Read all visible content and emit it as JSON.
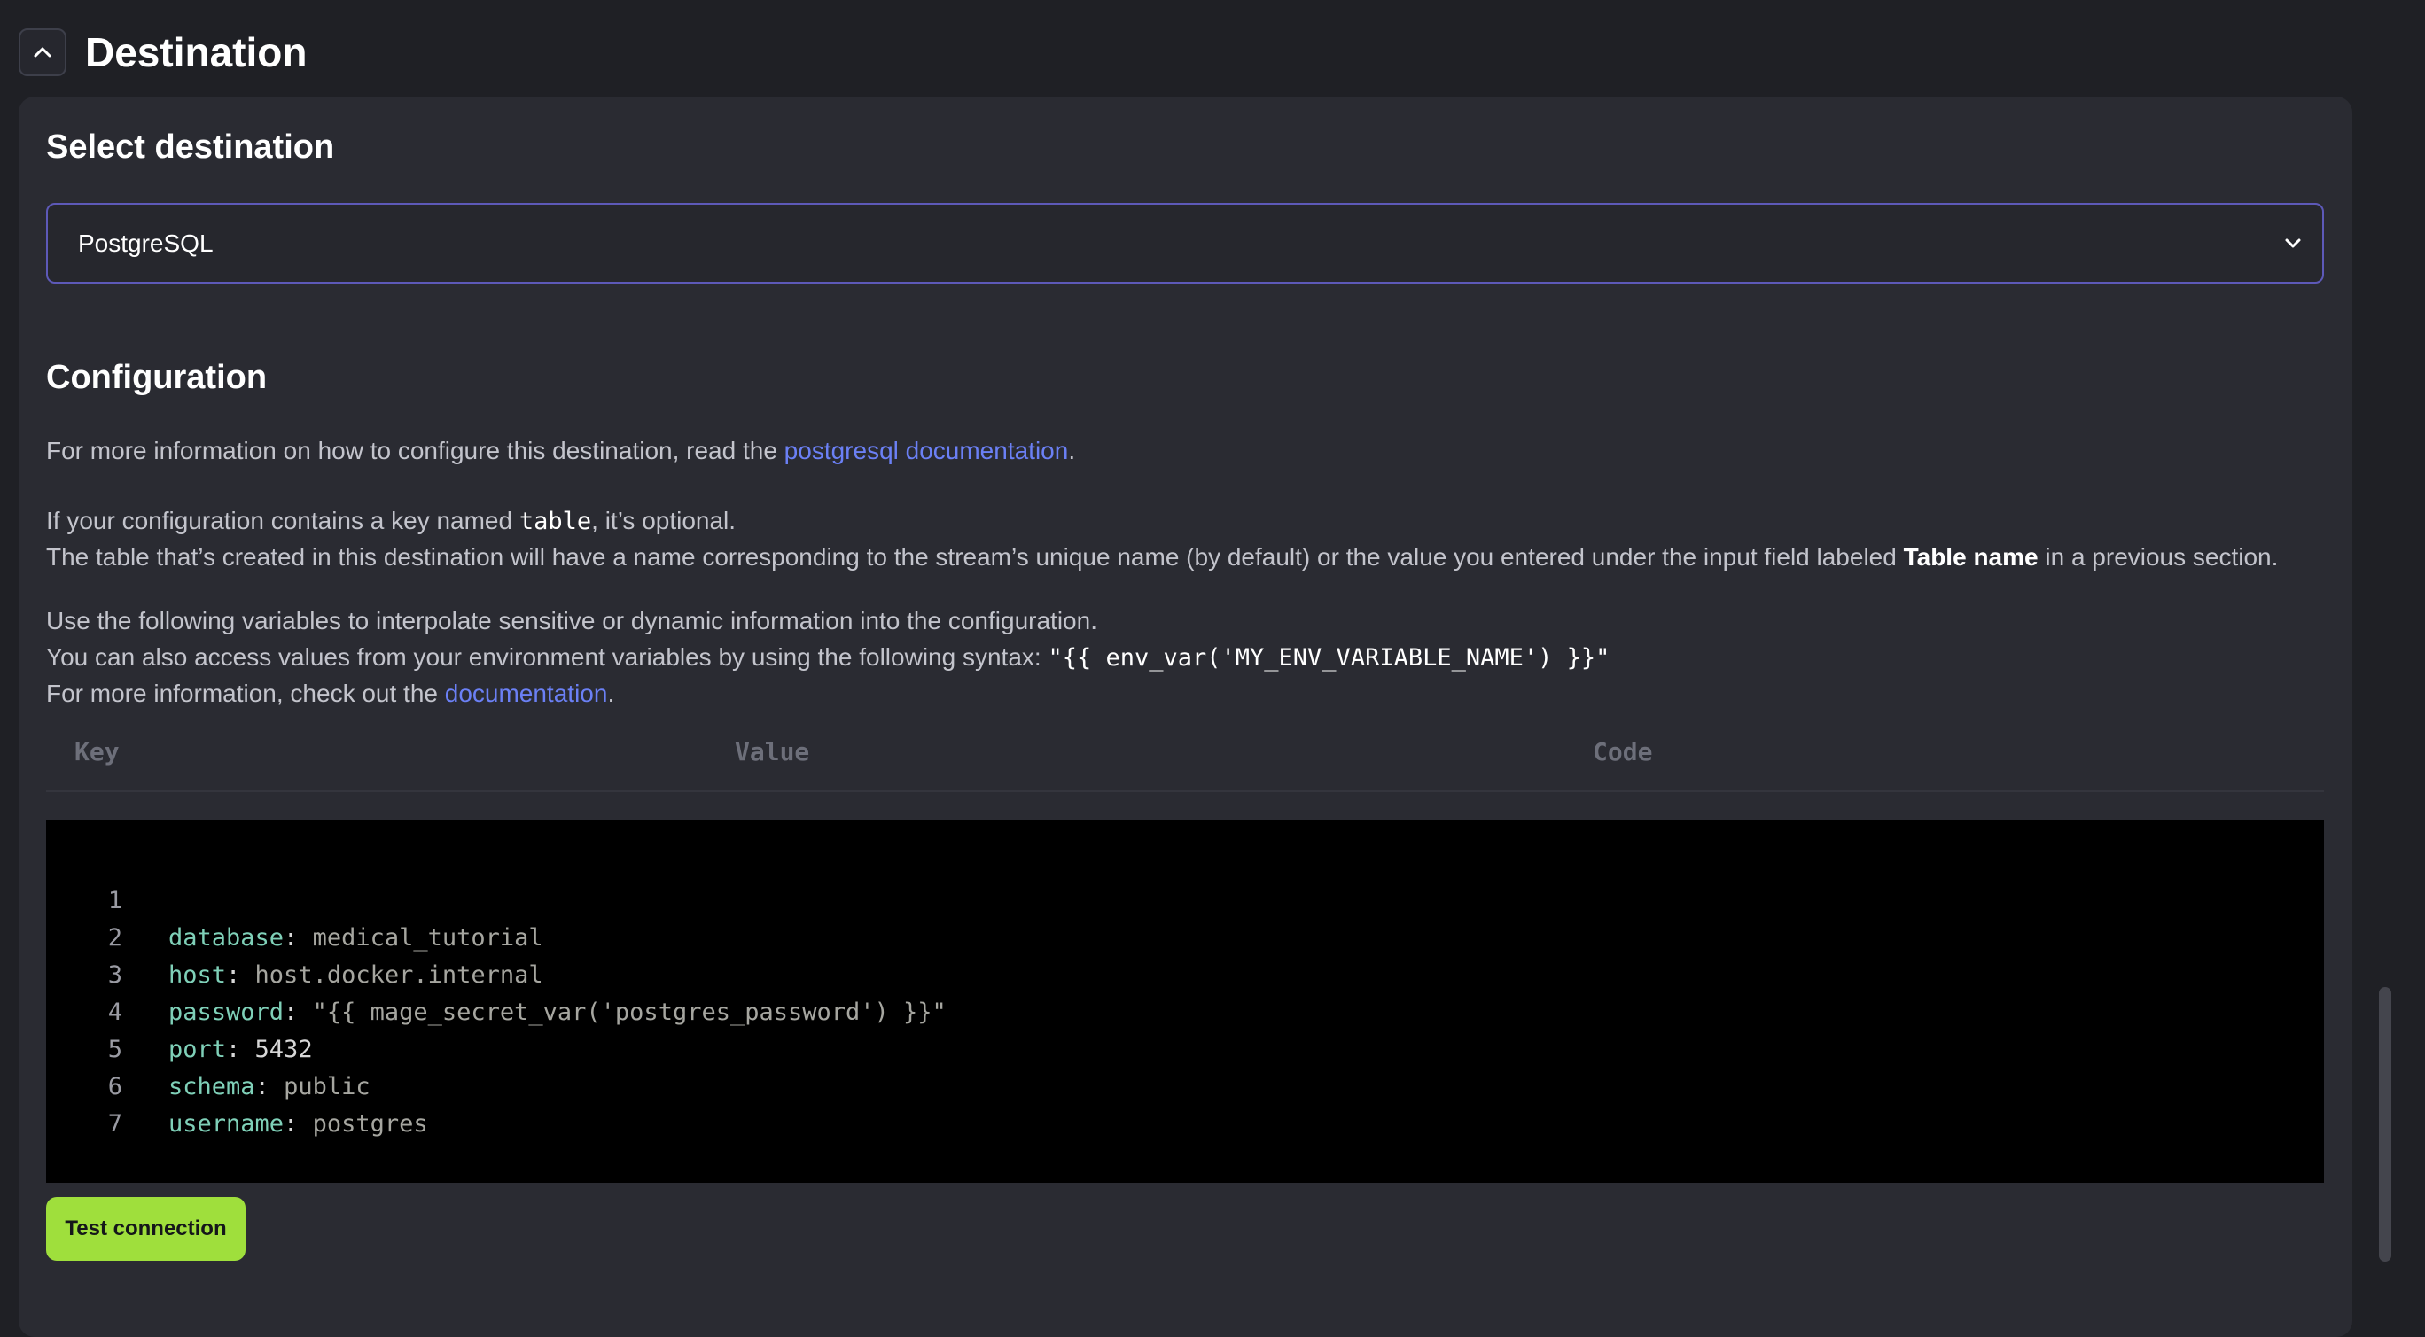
{
  "header": {
    "title": "Destination",
    "collapse_icon": "chevron-up-icon"
  },
  "select_destination": {
    "heading": "Select destination",
    "selected_value": "PostgreSQL",
    "dropdown_icon": "chevron-down-icon"
  },
  "configuration": {
    "heading": "Configuration",
    "info_line1_prefix": "For more information on how to configure this destination, read the ",
    "info_line1_link": "postgresql documentation",
    "info_line1_suffix": ".",
    "table_note_prefix": "If your configuration contains a key named ",
    "table_note_key": "table",
    "table_note_suffix": ", it’s optional.",
    "table_name_prefix": "The table that’s created in this destination will have a name corresponding to the stream’s unique name (by default) or the value you entered under the input field labeled ",
    "table_name_bold": "Table name",
    "table_name_suffix": " in a previous section.",
    "vars_line1": "Use the following variables to interpolate sensitive or dynamic information into the configuration.",
    "vars_line2_prefix": "You can also access values from your environment variables by using the following syntax: ",
    "vars_line2_code": "\"{{ env_var('MY_ENV_VARIABLE_NAME') }}\"",
    "vars_line3_prefix": "For more information, check out the ",
    "vars_line3_link": "documentation",
    "vars_line3_suffix": "."
  },
  "variables_table": {
    "columns": [
      "Key",
      "Value",
      "Code"
    ]
  },
  "editor": {
    "lines": [
      {
        "num": "1",
        "key": "database",
        "value": "medical_tutorial"
      },
      {
        "num": "2",
        "key": "host",
        "value": "host.docker.internal"
      },
      {
        "num": "3",
        "key": "password",
        "value": "\"{{ mage_secret_var('postgres_password') }}\""
      },
      {
        "num": "4",
        "key": "port",
        "value": "5432"
      },
      {
        "num": "5",
        "key": "schema",
        "value": "public"
      },
      {
        "num": "6",
        "key": "username",
        "value": "postgres"
      },
      {
        "num": "7",
        "key": "",
        "value": ""
      }
    ]
  },
  "actions": {
    "test_connection_label": "Test connection"
  },
  "colors": {
    "background": "#1f2025",
    "panel": "#2a2b32",
    "link": "#6b80f5",
    "accent_button": "#9fdf3c",
    "select_border": "#5d59b8",
    "editor_background": "#000000",
    "yaml_key": "#7fd0b8"
  }
}
